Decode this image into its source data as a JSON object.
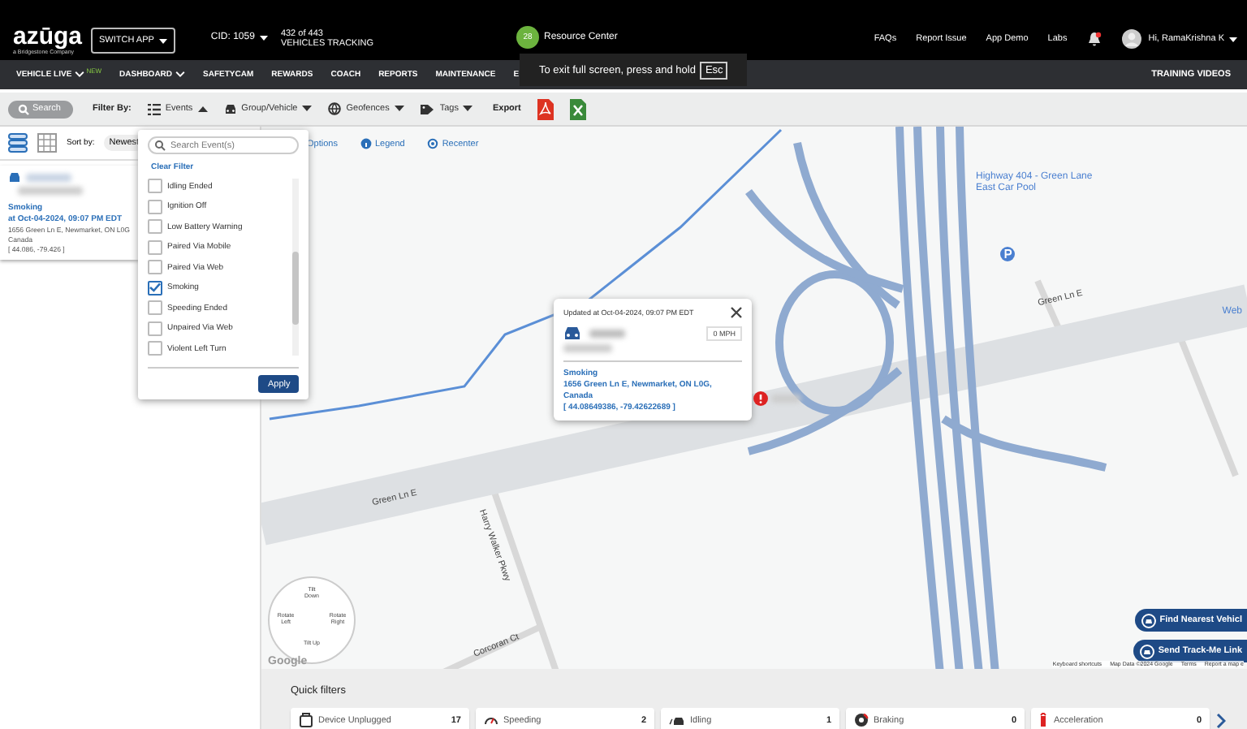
{
  "header": {
    "logo": "azūga",
    "tagline": "a Bridgestone Company",
    "switch_app": "SWITCH APP",
    "cid": "CID: 1059",
    "vehicles_count": "432 of 443",
    "vehicles_label": "VEHICLES TRACKING",
    "resource_badge": "28",
    "resource_label": "Resource Center",
    "links": [
      "FAQs",
      "Report Issue",
      "App Demo",
      "Labs"
    ],
    "user": "Hi, RamaKrishna K"
  },
  "fullscreen_tip": {
    "text": "To exit full screen, press and hold",
    "key": "Esc"
  },
  "nav": {
    "items": [
      {
        "label": "VEHICLE LIVE",
        "caret": true,
        "badge": "NEW"
      },
      {
        "label": "DASHBOARD",
        "caret": true
      },
      {
        "label": "SAFETYCAM",
        "caret": false
      },
      {
        "label": "REWARDS",
        "caret": false
      },
      {
        "label": "COACH",
        "caret": false
      },
      {
        "label": "REPORTS",
        "caret": false
      },
      {
        "label": "MAINTENANCE",
        "caret": false
      },
      {
        "label": "E",
        "caret": false
      }
    ],
    "right": "TRAINING VIDEOS"
  },
  "filter_bar": {
    "search": "Search",
    "filter_by": "Filter By:",
    "filters": [
      {
        "label": "Events",
        "kind": "events",
        "expanded": true
      },
      {
        "label": "Group/Vehicle",
        "kind": "vehicle",
        "expanded": false
      },
      {
        "label": "Geofences",
        "kind": "geofence",
        "expanded": false
      },
      {
        "label": "Tags",
        "kind": "tag",
        "expanded": false
      }
    ],
    "export": "Export"
  },
  "list_panel": {
    "sort_label": "Sort by:",
    "sort_value": "Newest",
    "card": {
      "event": "Smoking",
      "time": "at Oct-04-2024, 09:07 PM EDT",
      "address": "1656 Green Ln E, Newmarket, ON L0G",
      "country": "Canada",
      "coords": "[ 44.086, -79.426 ]"
    }
  },
  "events_dropdown": {
    "placeholder": "Search Event(s)",
    "clear": "Clear Filter",
    "items": [
      {
        "label": "Idling Ended",
        "checked": false
      },
      {
        "label": "Ignition Off",
        "checked": false
      },
      {
        "label": "Low Battery Warning",
        "checked": false
      },
      {
        "label": "Paired Via Mobile",
        "checked": false
      },
      {
        "label": "Paired Via Web",
        "checked": false
      },
      {
        "label": "Smoking",
        "checked": true
      },
      {
        "label": "Speeding Ended",
        "checked": false
      },
      {
        "label": "Unpaired Via Web",
        "checked": false
      },
      {
        "label": "Violent Left Turn",
        "checked": false
      }
    ],
    "apply": "Apply"
  },
  "map": {
    "toolbar": [
      {
        "label": "Options",
        "kind": "none"
      },
      {
        "label": "Legend",
        "kind": "info"
      },
      {
        "label": "Recenter",
        "kind": "target"
      }
    ],
    "place": "Highway 404 - Green Lane East Car Pool",
    "road_labels": [
      "Green Ln E",
      "Green Ln E",
      "Harry Walker Pkwy",
      "Corcoran Ct"
    ],
    "edge_label": "Web",
    "popup": {
      "updated": "Updated at Oct-04-2024, 09:07 PM EDT",
      "speed": "0 MPH",
      "event": "Smoking",
      "address": "1656 Green Ln E, Newmarket, ON L0G,",
      "country": "Canada",
      "coords": "[ 44.08649386, -79.42622689 ]"
    },
    "actions": [
      "Find Nearest Vehicl",
      "Send Track-Me Link"
    ],
    "rotate": {
      "up": "Tilt Down",
      "left": "Rotate Left",
      "right": "Rotate Right",
      "down": "Tilt Up"
    },
    "google": "Google",
    "attribution": [
      "Keyboard shortcuts",
      "Map Data ©2024 Google",
      "Terms",
      "Report a map e"
    ]
  },
  "quick_filters": {
    "title": "Quick filters",
    "items": [
      {
        "label": "Device Unplugged",
        "count": "17",
        "kind": "unplugged"
      },
      {
        "label": "Speeding",
        "count": "2",
        "kind": "speeding"
      },
      {
        "label": "Idling",
        "count": "1",
        "kind": "idling"
      },
      {
        "label": "Braking",
        "count": "0",
        "kind": "braking"
      },
      {
        "label": "Acceleration",
        "count": "0",
        "kind": "acceleration"
      }
    ]
  }
}
